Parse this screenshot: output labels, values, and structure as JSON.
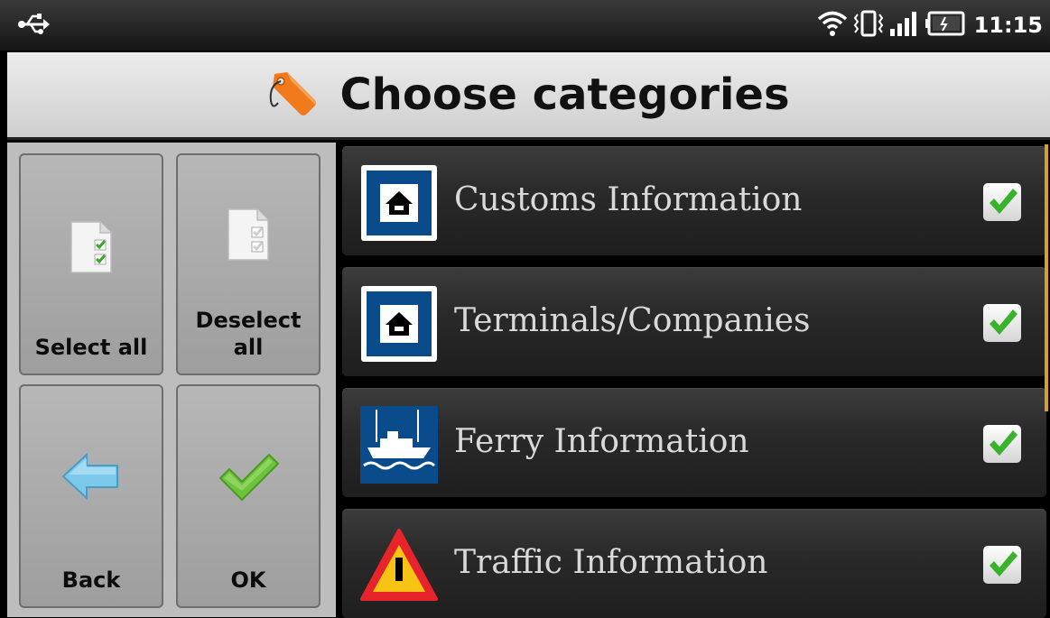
{
  "status_bar": {
    "time": "11:15",
    "icons": [
      "usb-icon",
      "wifi-icon",
      "vibrate-icon",
      "signal-icon",
      "battery-icon"
    ]
  },
  "header": {
    "title": "Choose categories",
    "icon": "tag-icon"
  },
  "actions": {
    "select_all": "Select all",
    "deselect_all_line1": "Deselect",
    "deselect_all_line2": "all",
    "back": "Back",
    "ok": "OK"
  },
  "categories": [
    {
      "label": "Customs Information",
      "icon": "house-sign-icon",
      "checked": true
    },
    {
      "label": "Terminals/Companies",
      "icon": "house-sign-icon",
      "checked": true
    },
    {
      "label": "Ferry Information",
      "icon": "ferry-icon",
      "checked": true
    },
    {
      "label": "Traffic Information",
      "icon": "warning-triangle-icon",
      "checked": true
    }
  ],
  "colors": {
    "accent_scroll": "#d9a21b",
    "check_green": "#38b32b",
    "sign_blue": "#0a4b8c"
  }
}
